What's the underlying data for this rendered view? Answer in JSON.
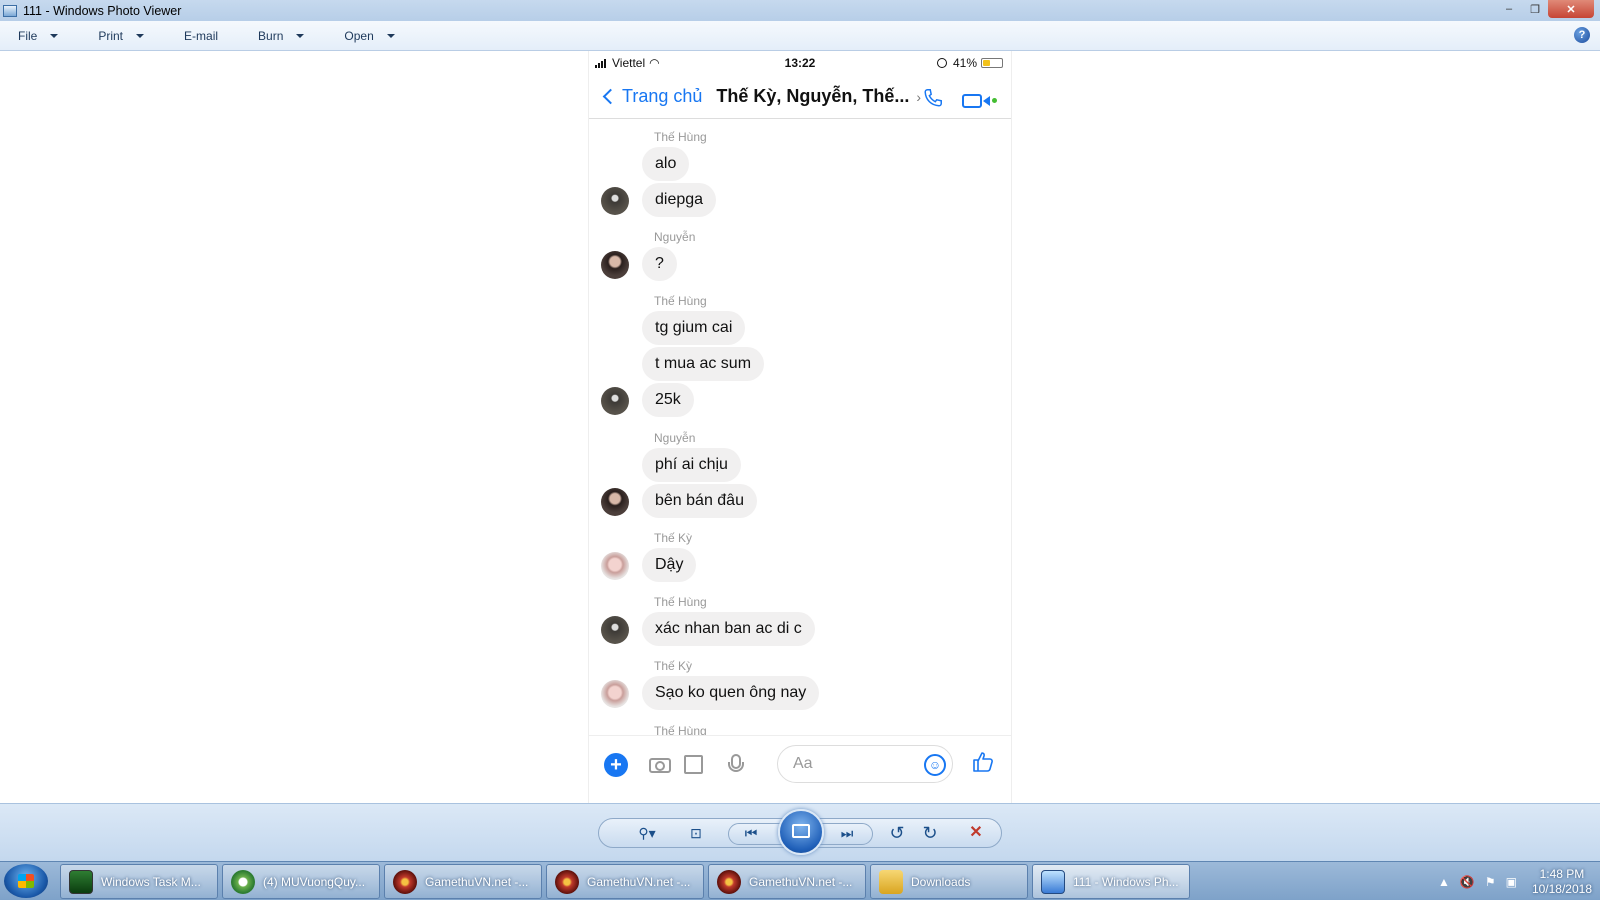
{
  "window": {
    "title": "111 - Windows Photo Viewer",
    "minimize": "–",
    "maximize": "❐",
    "close": "✕"
  },
  "menu": {
    "items": [
      {
        "label": "File",
        "has_dropdown": true
      },
      {
        "label": "Print",
        "has_dropdown": true
      },
      {
        "label": "E-mail",
        "has_dropdown": false
      },
      {
        "label": "Burn",
        "has_dropdown": true
      },
      {
        "label": "Open",
        "has_dropdown": true
      }
    ],
    "help": "?"
  },
  "phone": {
    "status": {
      "carrier": "Viettel",
      "time": "13:22",
      "battery": "41%",
      "battery_level": 0.41
    },
    "header": {
      "back_label": "Trang chủ",
      "conversation_title": "Thế Kỳ, Nguyễn, Thế...",
      "chevron": "›"
    },
    "messages": [
      {
        "sender": "Thế Hùng",
        "text": "alo"
      },
      {
        "sender": "",
        "text": "diepga",
        "avatar": "hung"
      },
      {
        "sender": "Nguyễn",
        "text": "?",
        "avatar": "nguyen"
      },
      {
        "sender": "Thế Hùng",
        "text": "tg gium cai"
      },
      {
        "sender": "",
        "text": "t mua ac sum"
      },
      {
        "sender": "",
        "text": "25k",
        "avatar": "hung"
      },
      {
        "sender": "Nguyễn",
        "text": "phí ai chịu"
      },
      {
        "sender": "",
        "text": "bên bán đâu",
        "avatar": "nguyen"
      },
      {
        "sender": "Thế Kỳ",
        "text": "Dậy",
        "avatar": "ky"
      },
      {
        "sender": "Thế Hùng",
        "text": "xác nhan ban ac di c",
        "avatar": "hung"
      },
      {
        "sender": "Thế Kỳ",
        "text": "Sạo ko quen ông nay",
        "avatar": "ky"
      },
      {
        "sender": "Thế Hùng",
        "text": ""
      }
    ],
    "composer": {
      "placeholder": "Aa",
      "plus": "+",
      "emoji": "☺",
      "like": "👍"
    }
  },
  "controls": {
    "zoom": "⚲▾",
    "fit": "⊡",
    "previous": "⏮",
    "next": "⏭",
    "rotate_ccw": "↺",
    "rotate_cw": "↻",
    "delete": "✕"
  },
  "taskbar": {
    "tasks": [
      {
        "label": "Windows Task M...",
        "icon": "taskman"
      },
      {
        "label": "(4) MUVuongQuy...",
        "icon": "browser"
      },
      {
        "label": "GamethuVN.net -...",
        "icon": "game"
      },
      {
        "label": "GamethuVN.net -...",
        "icon": "game"
      },
      {
        "label": "GamethuVN.net -...",
        "icon": "game"
      },
      {
        "label": "Downloads",
        "icon": "folder"
      },
      {
        "label": "111 - Windows Ph...",
        "icon": "photo",
        "active": true
      }
    ],
    "tray": {
      "show_hidden": "▲",
      "volume": "🔇",
      "flag": "⚑",
      "network": "▣"
    },
    "clock": {
      "time": "1:48 PM",
      "date": "10/18/2018"
    }
  }
}
